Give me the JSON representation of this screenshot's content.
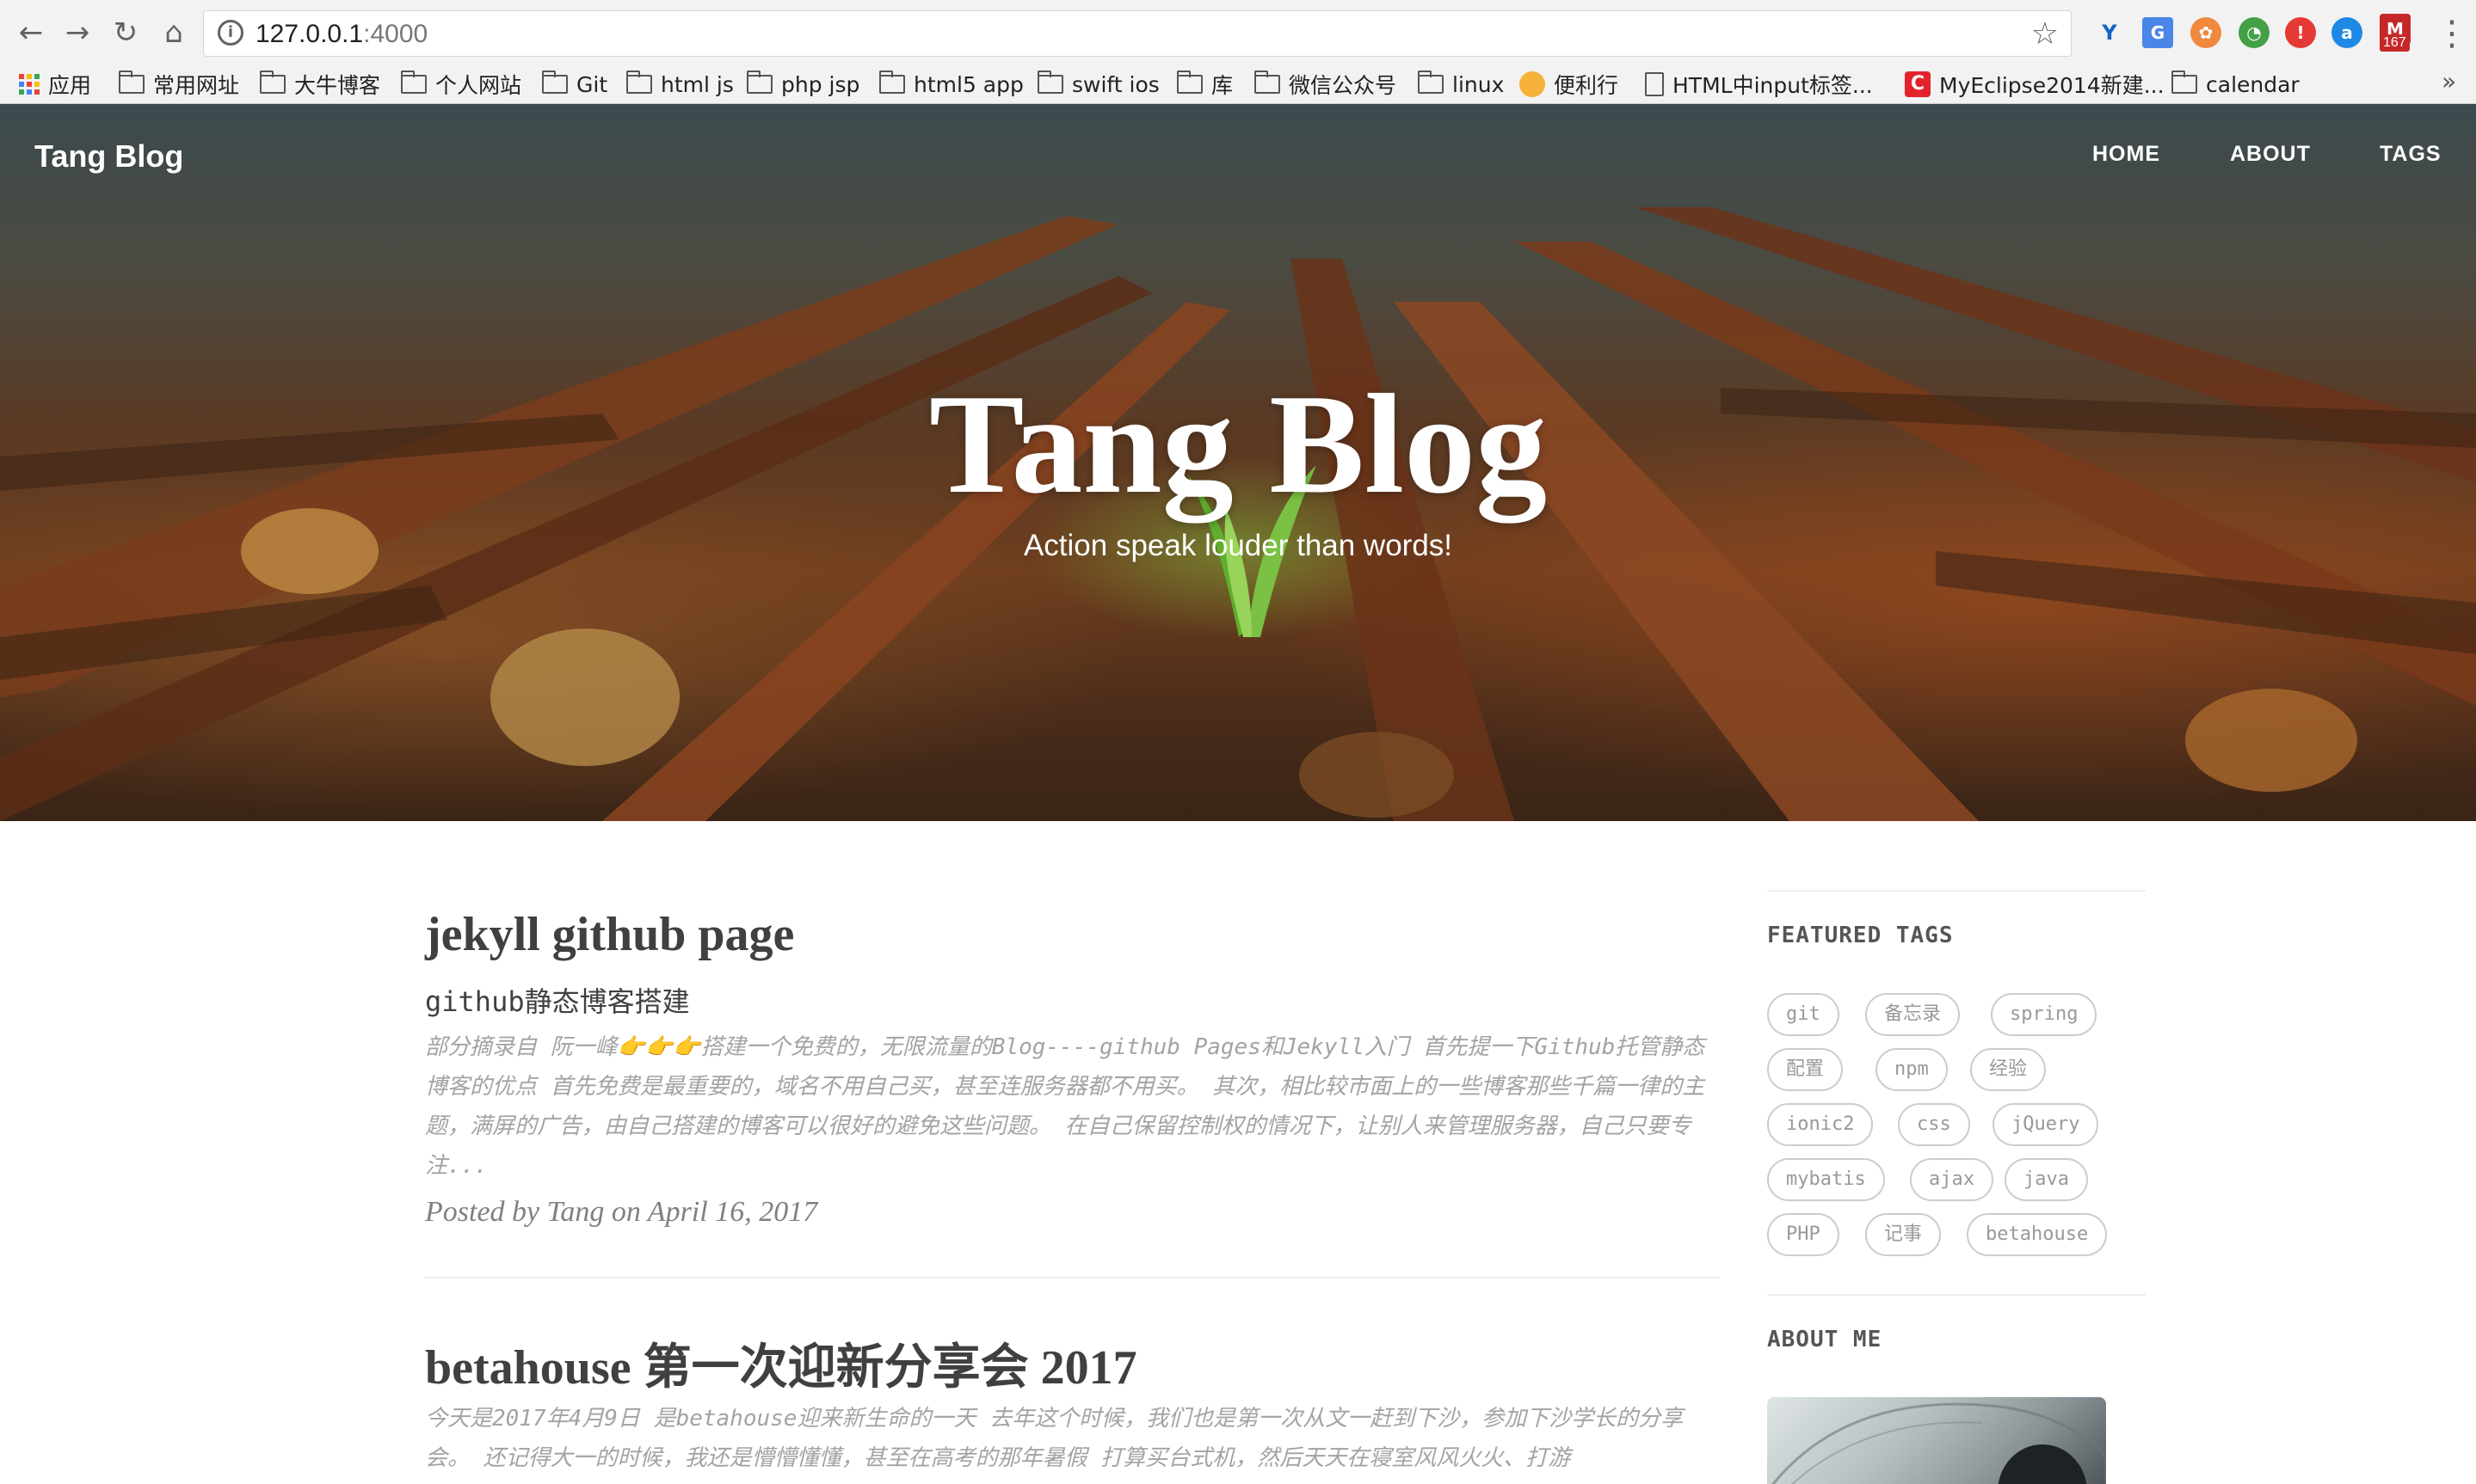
{
  "browser": {
    "url_host": "127.0.0.1",
    "url_port": ":4000",
    "extension_badge": "167",
    "bookmarks": [
      {
        "label": "应用",
        "icon": "apps-grid-icon"
      },
      {
        "label": "常用网址",
        "icon": "folder-icon"
      },
      {
        "label": "大牛博客",
        "icon": "folder-icon"
      },
      {
        "label": "个人网站",
        "icon": "folder-icon"
      },
      {
        "label": "Git",
        "icon": "folder-icon"
      },
      {
        "label": "html js",
        "icon": "folder-icon"
      },
      {
        "label": "php jsp",
        "icon": "folder-icon"
      },
      {
        "label": "html5 app",
        "icon": "folder-icon"
      },
      {
        "label": "swift ios",
        "icon": "folder-icon"
      },
      {
        "label": "库",
        "icon": "folder-icon"
      },
      {
        "label": "微信公众号",
        "icon": "folder-icon"
      },
      {
        "label": "linux",
        "icon": "folder-icon"
      },
      {
        "label": "便利行",
        "icon": "site-icon"
      },
      {
        "label": "HTML中input标签...",
        "icon": "document-icon"
      },
      {
        "label": "MyEclipse2014新建...",
        "icon": "red-c-icon"
      },
      {
        "label": "calendar",
        "icon": "folder-icon"
      }
    ],
    "bookmarks_more": "»"
  },
  "site": {
    "brand": "Tang Blog",
    "nav": [
      "HOME",
      "ABOUT",
      "TAGS"
    ],
    "hero_title": "Tang Blog",
    "hero_subtitle": "Action speak louder than words!"
  },
  "posts": [
    {
      "title": "jekyll github page",
      "subtitle": "github静态博客搭建",
      "excerpt": "部分摘录自 阮一峰👉👉👉搭建一个免费的，无限流量的Blog----github Pages和Jekyll入门 首先提一下Github托管静态博客的优点 首先免费是最重要的，域名不用自己买，甚至连服务器都不用买。 其次，相比较市面上的一些博客那些千篇一律的主题，满屏的广告，由自己搭建的博客可以很好的避免这些问题。 在自己保留控制权的情况下，让别人来管理服务器，自己只要专注...",
      "meta": "Posted by Tang on April 16, 2017"
    },
    {
      "title": "betahouse 第一次迎新分享会 2017",
      "excerpt": "今天是2017年4月9日 是betahouse迎来新生命的一天 去年这个时候，我们也是第一次从文一赶到下沙，参加下沙学长的分享会。 还记得大一的时候，我还是懵懵懂懂，甚至在高考的那年暑假 打算买台式机，然后天天在寝室风风火火、打游"
    }
  ],
  "sidebar": {
    "featured_tags_heading": "FEATURED TAGS",
    "tags": [
      "git",
      "备忘录",
      "spring",
      "配置",
      "npm",
      "经验",
      "ionic2",
      "css",
      "jQuery",
      "mybatis",
      "ajax",
      "java",
      "PHP",
      "记事",
      "betahouse"
    ],
    "about_heading": "ABOUT ME"
  }
}
